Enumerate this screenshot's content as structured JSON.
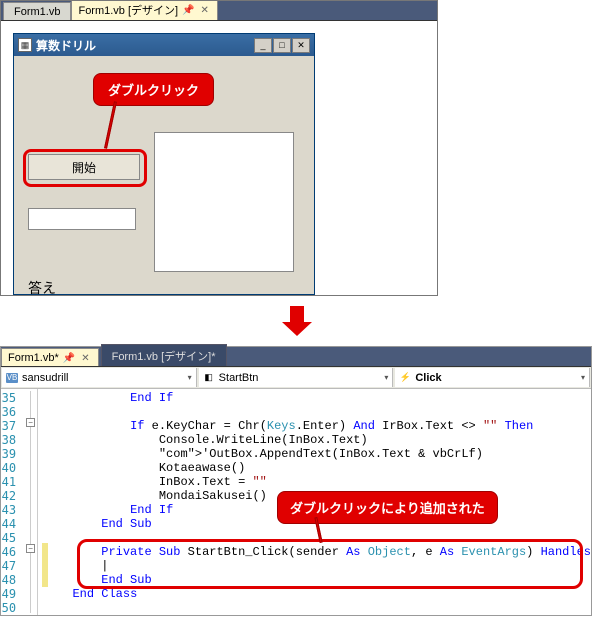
{
  "top_tabs": {
    "inactive": "Form1.vb",
    "active": "Form1.vb [デザイン]"
  },
  "form": {
    "title": "算数ドリル",
    "start_btn": "開始",
    "answer_label": "答え"
  },
  "callout_top": "ダブルクリック",
  "bottom_tabs": {
    "active": "Form1.vb*",
    "inactive": "Form1.vb [デザイン]*"
  },
  "dropdowns": {
    "left": "sansudrill",
    "mid": "StartBtn",
    "right": "Click"
  },
  "callout_bottom": "ダブルクリックにより追加された",
  "code": {
    "lines": [
      {
        "n": 35,
        "t": "            End If"
      },
      {
        "n": 36,
        "t": ""
      },
      {
        "n": 37,
        "t": "            If e.KeyChar = Chr(Keys.Enter) And IrBox.Text <> \"\" Then"
      },
      {
        "n": 38,
        "t": "                Console.WriteLine(InBox.Text)"
      },
      {
        "n": 39,
        "t": "                'OutBox.AppendText(InBox.Text & vbCrLf)"
      },
      {
        "n": 40,
        "t": "                Kotaeawase()"
      },
      {
        "n": 41,
        "t": "                InBox.Text = \"\""
      },
      {
        "n": 42,
        "t": "                MondaiSakusei()"
      },
      {
        "n": 43,
        "t": "            End If"
      },
      {
        "n": 44,
        "t": "        End Sub"
      },
      {
        "n": 45,
        "t": ""
      },
      {
        "n": 46,
        "t": "        Private Sub StartBtn_Click(sender As Object, e As EventArgs) Handles"
      },
      {
        "n": 47,
        "t": "        |"
      },
      {
        "n": 48,
        "t": "        End Sub"
      },
      {
        "n": 49,
        "t": "    End Class"
      },
      {
        "n": 50,
        "t": ""
      }
    ]
  }
}
